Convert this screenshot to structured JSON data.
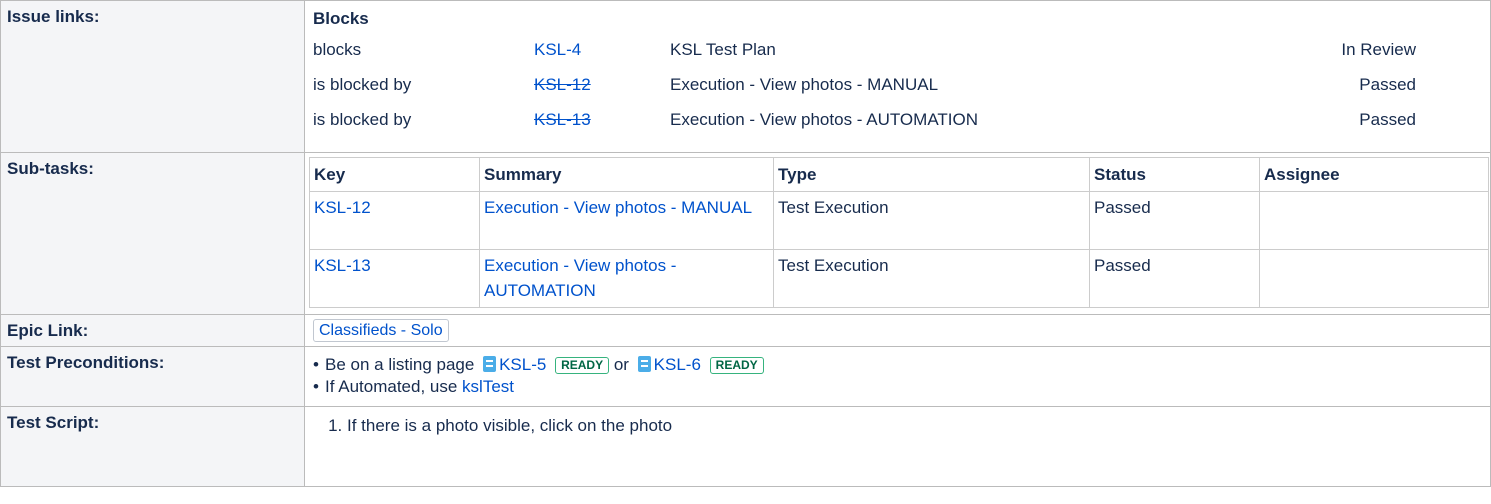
{
  "issue_links": {
    "label": "Issue links:",
    "group_title": "Blocks",
    "rows": [
      {
        "relation": "blocks",
        "key": "KSL-4",
        "summary": "KSL Test Plan",
        "status": "In Review"
      },
      {
        "relation": "is blocked by",
        "key": "KSL-12",
        "summary": "Execution - View photos - MANUAL",
        "status": "Passed"
      },
      {
        "relation": "is blocked by",
        "key": "KSL-13",
        "summary": "Execution - View photos - AUTOMATION",
        "status": "Passed"
      }
    ]
  },
  "subtasks": {
    "label": "Sub-tasks:",
    "headers": [
      "Key",
      "Summary",
      "Type",
      "Status",
      "Assignee"
    ],
    "rows": [
      {
        "key": "KSL-12",
        "summary": "Execution - View photos - MANUAL",
        "type": "Test Execution",
        "status": "Passed",
        "assignee": ""
      },
      {
        "key": "KSL-13",
        "summary": "Execution - View photos - AUTOMATION",
        "type": "Test Execution",
        "status": "Passed",
        "assignee": ""
      }
    ]
  },
  "epic": {
    "label": "Epic Link:",
    "value": "Classifieds - Solo"
  },
  "preconditions": {
    "label": "Test Preconditions:",
    "line1_prefix": "Be on a listing page",
    "item1_key": "KSL-5",
    "item1_status": "READY",
    "or_text": "or",
    "item2_key": "KSL-6",
    "item2_status": "READY",
    "line2_prefix": "If Automated, use",
    "line2_link": "kslTest"
  },
  "script": {
    "label": "Test Script:",
    "steps": [
      "If there is a photo visible, click on the photo"
    ]
  },
  "colors": {
    "link": "#0052cc",
    "label_bg": "#f4f5f7",
    "ready_lozenge": "#36b37e",
    "doc_icon": "#4bade8"
  },
  "icons": [
    "document-icon"
  ]
}
